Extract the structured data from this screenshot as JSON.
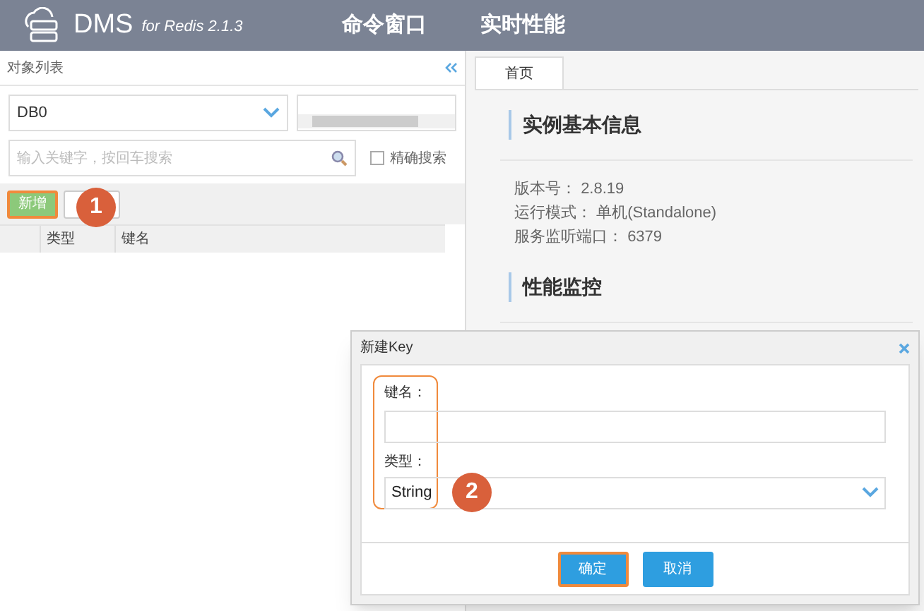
{
  "header": {
    "logo_title": "DMS",
    "logo_subtitle": "for Redis 2.1.3",
    "nav": [
      {
        "label": "命令窗口"
      },
      {
        "label": "实时性能"
      }
    ]
  },
  "sidebar": {
    "title": "对象列表",
    "db_select": "DB0",
    "search": {
      "placeholder": "输入关键字，按回车搜索"
    },
    "exact_search": {
      "label": "精确搜索",
      "checked": false
    },
    "add_button": "新增",
    "callout": "1",
    "columns": [
      "类型",
      "键名"
    ]
  },
  "main": {
    "tabs": [
      {
        "label": "首页",
        "selected": true
      }
    ],
    "sections": [
      {
        "title": "实例基本信息",
        "rows": [
          {
            "label": "版本号：",
            "value": "2.8.19"
          },
          {
            "label": "运行模式：",
            "value": "单机(Standalone)"
          },
          {
            "label": "服务监听端口：",
            "value": "6379"
          }
        ]
      },
      {
        "title": "性能监控"
      }
    ]
  },
  "dialog": {
    "title": "新建Key",
    "callout": "2",
    "fields": [
      {
        "kind": "text",
        "label": "键名："
      },
      {
        "kind": "select",
        "label": "类型：",
        "value": "String"
      }
    ],
    "buttons": [
      {
        "label": "确定",
        "highlighted": true
      },
      {
        "label": "取消",
        "highlighted": false
      }
    ]
  }
}
